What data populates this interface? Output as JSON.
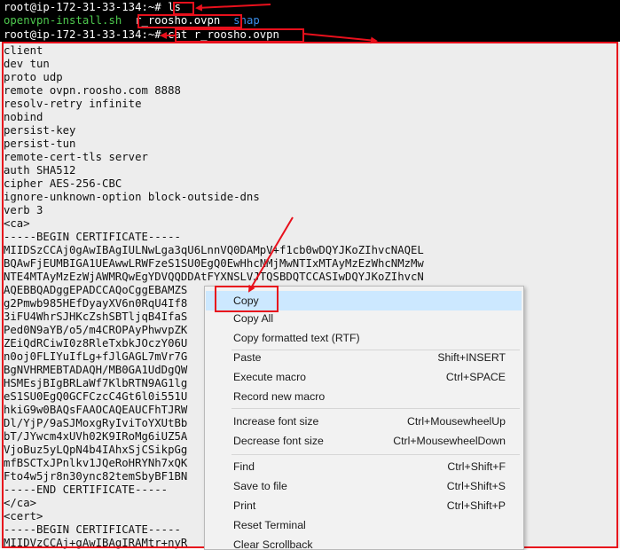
{
  "terminal": {
    "top_lines": [
      {
        "prompt": "root@ip-172-31-33-134:~# ",
        "command": "ls"
      },
      {
        "files": [
          "openvpn-install.sh",
          "r_roosho.ovpn",
          "snap"
        ]
      },
      {
        "prompt": "root@ip-172-31-33-134:~# ",
        "command": "cat r_roosho.ovpn"
      }
    ],
    "body_lines": [
      "client",
      "dev tun",
      "proto udp",
      "remote ovpn.roosho.com 8888",
      "resolv-retry infinite",
      "nobind",
      "persist-key",
      "persist-tun",
      "remote-cert-tls server",
      "auth SHA512",
      "cipher AES-256-CBC",
      "ignore-unknown-option block-outside-dns",
      "verb 3",
      "<ca>",
      "-----BEGIN CERTIFICATE-----",
      "MIIDSzCCAj0gAwIBAgIULNwLga3qU6LnnVQ0DAMpV+f1cb0wDQYJKoZIhvcNAQEL",
      "BQAwFjEUMBIGA1UEAwwLRWFzeS1SU0EgQ0EwHhcNMjMwNTIxMTAyMzEzWhcNMzMw",
      "NTE4MTAyMzEzWjAWMRQwEgYDVQQDDAtFYXNSLVJTQSBDQTCCASIwDQYJKoZIhvcN",
      "AQEBBQADggEPADCCAQoCggEBAMZS",
      "g2Pmwb985HEfDyayXV6n0RqU4If8",
      "3iFU4WhrSJHKcZshSBTljqB4IfaS",
      "Ped0N9aYB/o5/m4CROPAyPhwvpZK",
      "ZEiQdRCiwI0z8RleTxbkJOczY06U",
      "n0oj0FLIYuIfLg+fJlGAGL7mVr7G",
      "BgNVHRMEBTADAQH/MB0GA1UdDgQW",
      "HSMEsjBIgBRLaWf7KlbRTN9AG1lg",
      "eS1SU0EgQ0GCFCzcC4Gt6l0i551U",
      "hkiG9w0BAQsFAAOCAQEAUCFhTJRW",
      "Dl/YjP/9aSJMoxgRyIviToYXUtBb",
      "bT/JYwcm4xUVh02K9IRoMg6iUZ5A",
      "VjoBuz5yLQpN4b4IAhxSjCSikpGg",
      "mfBSCTxJPnlkv1JQeRoHRYNh7xQK",
      "Fto4w5jr8n30ync82temSbyBF1BN",
      "-----END CERTIFICATE-----",
      "</ca>",
      "<cert>",
      "-----BEGIN CERTIFICATE-----",
      "MIIDVzCCAj+gAwIBAgIRAMtr+nyR"
    ]
  },
  "context_menu": {
    "items": [
      {
        "name": "menu-item-copy",
        "label": "Copy",
        "shortcut": ""
      },
      {
        "name": "menu-item-copy-all",
        "label": "Copy All",
        "shortcut": ""
      },
      {
        "name": "menu-item-copy-rtf",
        "label": "Copy formatted text (RTF)",
        "shortcut": ""
      },
      {
        "name": "menu-item-paste",
        "label": "Paste",
        "shortcut": "Shift+INSERT"
      },
      {
        "name": "menu-item-execute-macro",
        "label": "Execute macro",
        "shortcut": "Ctrl+SPACE"
      },
      {
        "name": "menu-item-record-macro",
        "label": "Record new macro",
        "shortcut": ""
      },
      {
        "name": "menu-item-increase-font",
        "label": "Increase font size",
        "shortcut": "Ctrl+MousewheelUp"
      },
      {
        "name": "menu-item-decrease-font",
        "label": "Decrease font size",
        "shortcut": "Ctrl+MousewheelDown"
      },
      {
        "name": "menu-item-find",
        "label": "Find",
        "shortcut": "Ctrl+Shift+F"
      },
      {
        "name": "menu-item-save-to-file",
        "label": "Save to file",
        "shortcut": "Ctrl+Shift+S"
      },
      {
        "name": "menu-item-print",
        "label": "Print",
        "shortcut": "Ctrl+Shift+P"
      },
      {
        "name": "menu-item-reset-terminal",
        "label": "Reset Terminal",
        "shortcut": ""
      },
      {
        "name": "menu-item-clear-scrollback",
        "label": "Clear Scrollback",
        "shortcut": ""
      }
    ],
    "highlighted": "Copy"
  },
  "colors": {
    "annotation": "#e8101c",
    "terminal_bg": "#000000",
    "output_bg": "#ededed",
    "filename_green": "#4ec94e",
    "dir_blue": "#3b8eea",
    "menu_highlight": "#cce8ff"
  }
}
